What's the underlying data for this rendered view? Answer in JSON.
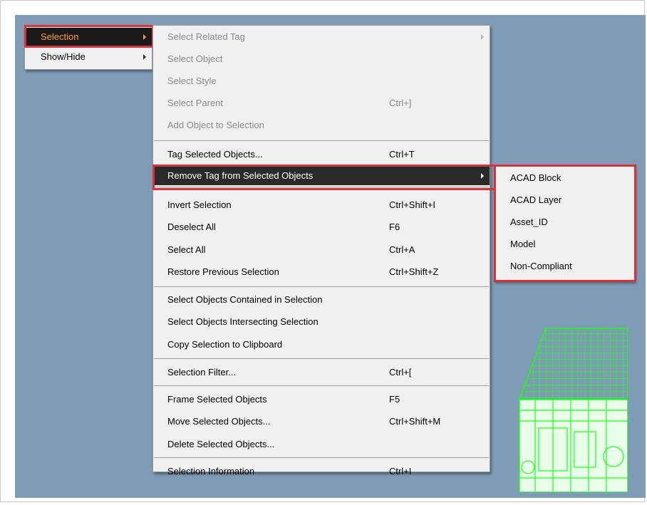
{
  "main_menu": {
    "items": [
      {
        "label": "Selection"
      },
      {
        "label": "Show/Hide"
      }
    ]
  },
  "selection_menu": {
    "items": [
      {
        "label": "Select Related Tag",
        "shortcut": ""
      },
      {
        "label": "Select Object",
        "shortcut": ""
      },
      {
        "label": "Select Style",
        "shortcut": ""
      },
      {
        "label": "Select Parent",
        "shortcut": "Ctrl+]"
      },
      {
        "label": "Add Object to Selection",
        "shortcut": ""
      },
      {
        "label": "Tag Selected Objects...",
        "shortcut": "Ctrl+T"
      },
      {
        "label": "Remove Tag from Selected Objects",
        "shortcut": ""
      },
      {
        "label": "Invert Selection",
        "shortcut": "Ctrl+Shift+I"
      },
      {
        "label": "Deselect All",
        "shortcut": "F6"
      },
      {
        "label": "Select All",
        "shortcut": "Ctrl+A"
      },
      {
        "label": "Restore Previous Selection",
        "shortcut": "Ctrl+Shift+Z"
      },
      {
        "label": "Select Objects Contained in Selection",
        "shortcut": ""
      },
      {
        "label": "Select Objects Intersecting Selection",
        "shortcut": ""
      },
      {
        "label": "Copy Selection to Clipboard",
        "shortcut": ""
      },
      {
        "label": "Selection Filter...",
        "shortcut": "Ctrl+["
      },
      {
        "label": "Frame Selected Objects",
        "shortcut": "F5"
      },
      {
        "label": "Move Selected Objects...",
        "shortcut": "Ctrl+Shift+M"
      },
      {
        "label": "Delete Selected Objects...",
        "shortcut": ""
      },
      {
        "label": "Selection Information",
        "shortcut": "Ctrl+I"
      }
    ]
  },
  "tag_submenu": {
    "items": [
      {
        "label": "ACAD Block"
      },
      {
        "label": "ACAD Layer"
      },
      {
        "label": "Asset_ID"
      },
      {
        "label": "Model"
      },
      {
        "label": "Non-Compliant"
      }
    ]
  },
  "colors": {
    "viewport_background": "#7f9bb5",
    "highlight_background": "#2a2a2a",
    "annotation_red": "#d8333b",
    "model_wireframe": "#19ff19"
  }
}
